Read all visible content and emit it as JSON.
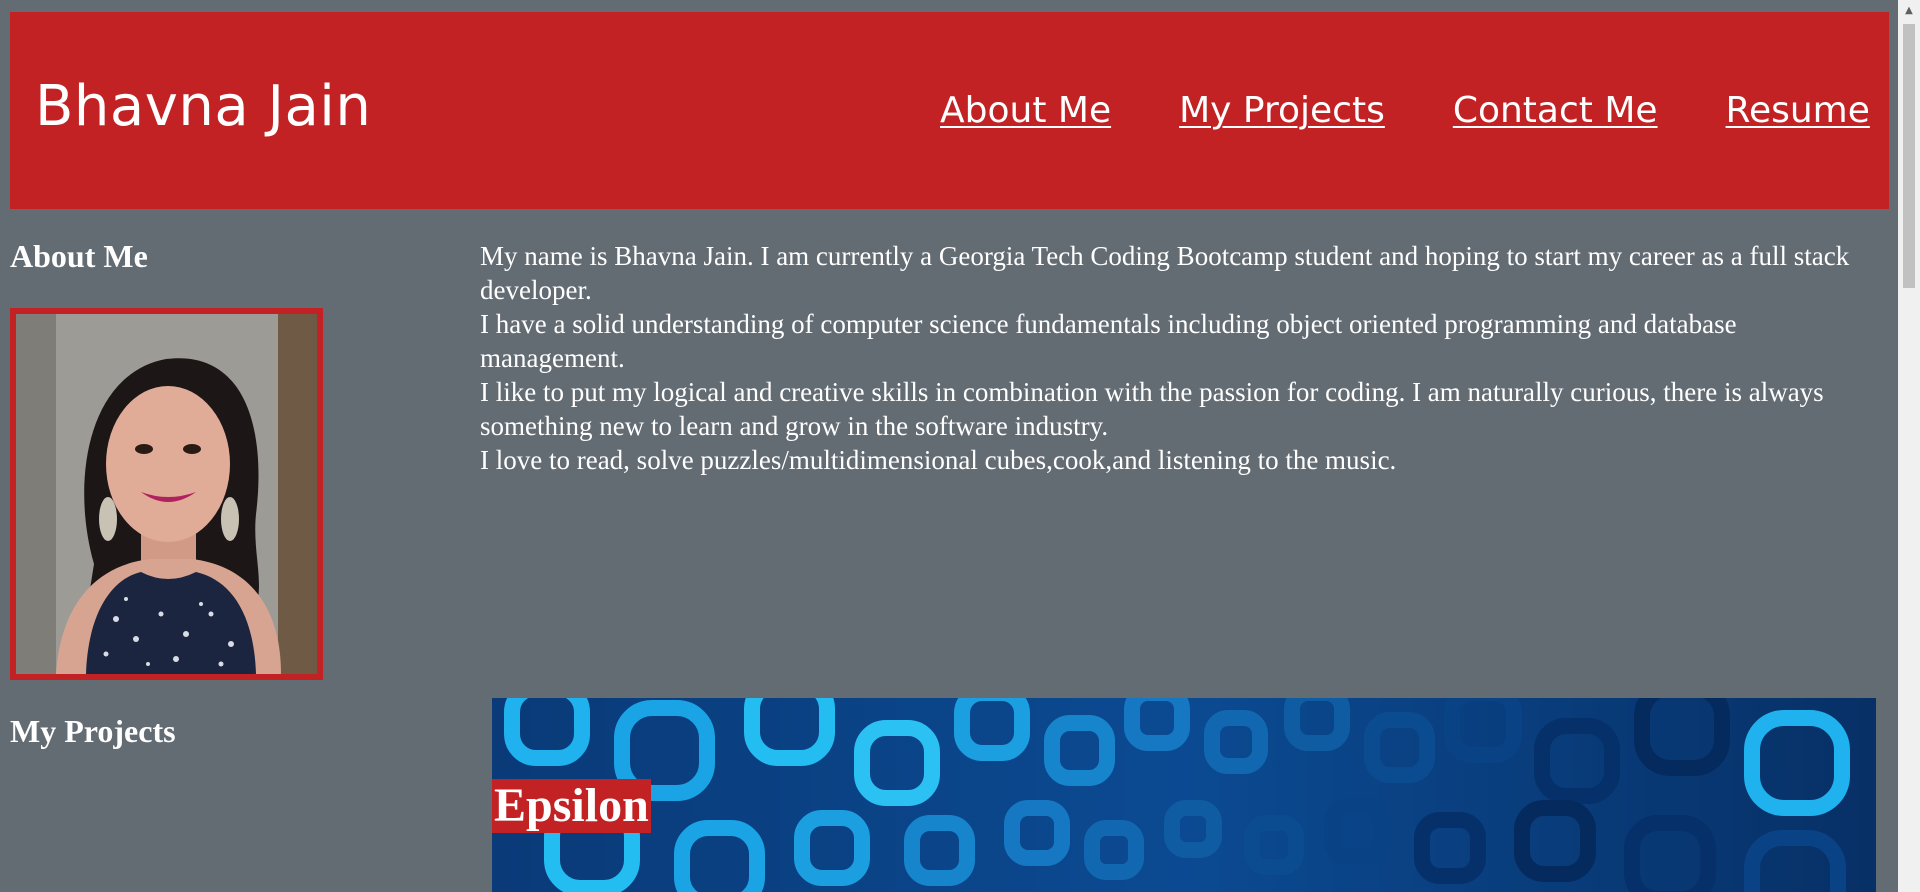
{
  "header": {
    "title": "Bhavna Jain",
    "nav": [
      "About Me",
      "My Projects",
      "Contact Me",
      "Resume"
    ]
  },
  "about": {
    "heading": "About Me",
    "photo_alt": "portrait photo",
    "paragraphs": [
      "My name is Bhavna Jain. I am currently a Georgia Tech Coding Bootcamp student and hoping to start my career as a full stack developer.",
      "I have a solid understanding of computer science fundamentals including object oriented programming and database management.",
      "I like to put my logical and creative skills in combination with the passion for coding. I am naturally curious, there is always something new to learn and grow in the software industry.",
      "I love to read, solve puzzles/multidimensional cubes,cook,and listening to the music."
    ]
  },
  "projects": {
    "heading": "My Projects",
    "items": [
      {
        "label": "Epsilon"
      }
    ]
  },
  "scrollbar": {
    "up_arrow": "▲"
  },
  "colors": {
    "background": "#636b73",
    "accent": "#c22223",
    "text": "#ffffff"
  }
}
